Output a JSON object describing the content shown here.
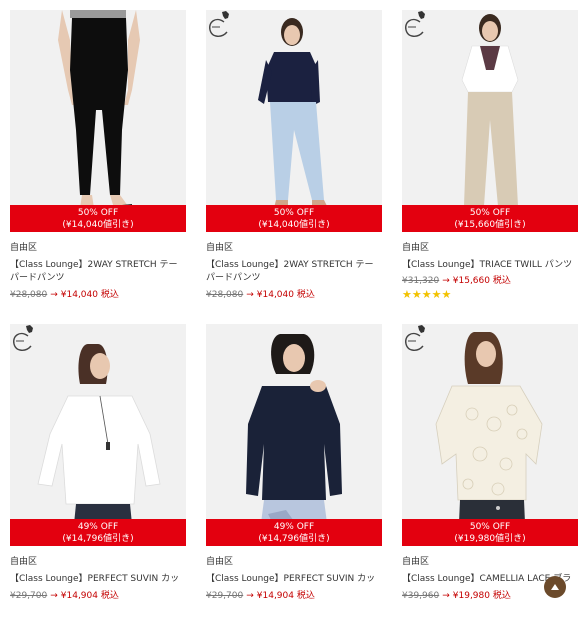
{
  "products": [
    {
      "brand": "自由区",
      "name": "【Class Lounge】2WAY STRETCH テーパードパンツ",
      "badge_off": "50% OFF",
      "badge_discount": "(¥14,040値引き)",
      "old_price": "¥28,080",
      "arrow": "→",
      "new_price": "¥14,040 税込",
      "logo": false,
      "stars": "",
      "photo": "pants-black"
    },
    {
      "brand": "自由区",
      "name": "【Class Lounge】2WAY STRETCH テーパードパンツ",
      "badge_off": "50% OFF",
      "badge_discount": "(¥14,040値引き)",
      "old_price": "¥28,080",
      "arrow": "→",
      "new_price": "¥14,040 税込",
      "logo": true,
      "stars": "",
      "photo": "navy-top-jeans"
    },
    {
      "brand": "自由区",
      "name": "【Class Lounge】TRIACE TWILL パンツ",
      "badge_off": "50% OFF",
      "badge_discount": "(¥15,660値引き)",
      "old_price": "¥31,320",
      "arrow": "→",
      "new_price": "¥15,660 税込",
      "logo": true,
      "stars": "★★★★★",
      "photo": "white-blouse-beige"
    },
    {
      "brand": "自由区",
      "name": "【Class Lounge】PERFECT SUVIN カットソー",
      "badge_off": "49% OFF",
      "badge_discount": "(¥14,796値引き)",
      "old_price": "¥29,700",
      "arrow": "→",
      "new_price": "¥14,904 税込",
      "logo": true,
      "stars": "",
      "photo": "white-cutsew"
    },
    {
      "brand": "自由区",
      "name": "【Class Lounge】PERFECT SUVIN カットソー",
      "badge_off": "49% OFF",
      "badge_discount": "(¥14,796値引き)",
      "old_price": "¥29,700",
      "arrow": "→",
      "new_price": "¥14,904 税込",
      "logo": false,
      "stars": "",
      "photo": "navy-cutsew"
    },
    {
      "brand": "自由区",
      "name": "【Class Lounge】CAMELLIA LACE ブラ",
      "badge_off": "50% OFF",
      "badge_discount": "(¥19,980値引き)",
      "old_price": "¥39,960",
      "arrow": "→",
      "new_price": "¥19,980 税込",
      "logo": true,
      "stars": "",
      "photo": "lace-blouse"
    }
  ],
  "logo_icon": "class-lounge-c-logo",
  "scroll_top_icon": "chevron-up-icon",
  "colors": {
    "badge": "#e3000f",
    "sale_price": "#c40000",
    "star": "#f2c200",
    "scroll_button": "#6b4a2b"
  }
}
